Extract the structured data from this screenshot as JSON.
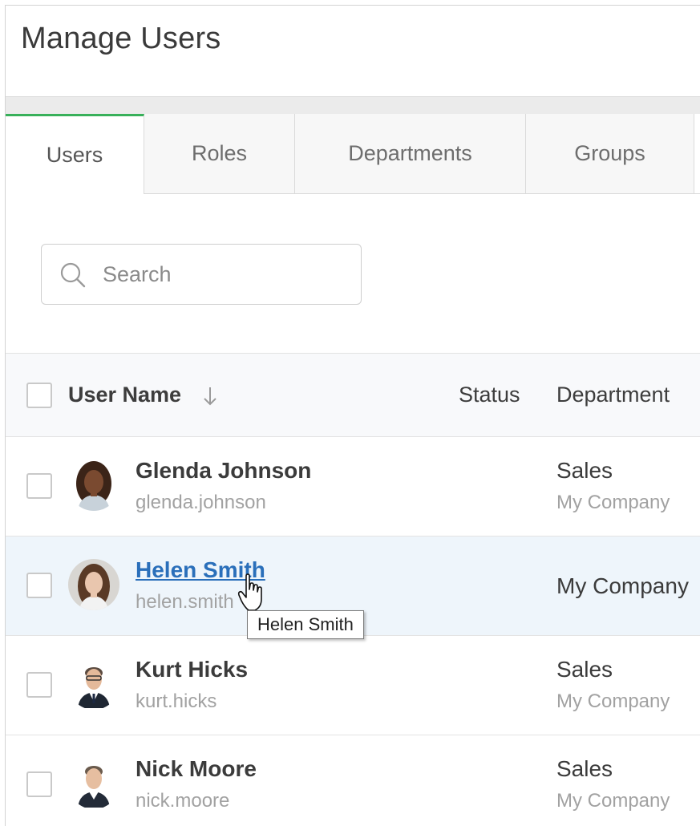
{
  "page": {
    "title": "Manage Users"
  },
  "tabs": [
    {
      "label": "Users",
      "active": true
    },
    {
      "label": "Roles",
      "active": false
    },
    {
      "label": "Departments",
      "active": false
    },
    {
      "label": "Groups",
      "active": false
    }
  ],
  "search": {
    "placeholder": "Search",
    "value": ""
  },
  "grid": {
    "columns": {
      "user_name": "User Name",
      "status": "Status",
      "department": "Department"
    },
    "sort": {
      "column": "User Name",
      "direction": "descending"
    },
    "rows": [
      {
        "name": "Glenda Johnson",
        "login": "glenda.johnson",
        "department": "Sales",
        "company": "My Company",
        "status": ""
      },
      {
        "name": "Helen Smith",
        "login": "helen.smith",
        "department": "",
        "company": "My Company",
        "status": ""
      },
      {
        "name": "Kurt Hicks",
        "login": "kurt.hicks",
        "department": "Sales",
        "company": "My Company",
        "status": ""
      },
      {
        "name": "Nick Moore",
        "login": "nick.moore",
        "department": "Sales",
        "company": "My Company",
        "status": ""
      }
    ]
  },
  "tooltip": {
    "text": "Helen Smith"
  },
  "colors": {
    "accent": "#38b05a",
    "link": "#2a6fba",
    "hover_row": "#eef5fb"
  }
}
